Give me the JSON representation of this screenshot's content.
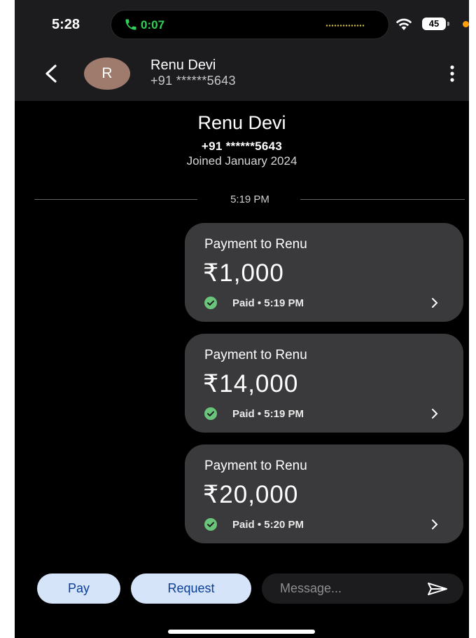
{
  "status_bar": {
    "time": "5:28",
    "call_timer": "0:07",
    "battery": "45",
    "icons": [
      "phone-call-icon",
      "wifi-icon",
      "battery-icon"
    ],
    "call_color": "#30d158",
    "indicator_color": "#ff9f0a"
  },
  "header": {
    "back_icon": "chevron-left-icon",
    "avatar_initial": "R",
    "avatar_color": "#9e7b6c",
    "name": "Renu Devi",
    "phone": "+91 ******5643",
    "menu_icon": "more-vertical-icon"
  },
  "contact": {
    "name": "Renu Devi",
    "phone": "+91 ******5643",
    "joined": "Joined January 2024"
  },
  "divider_time": "5:19 PM",
  "payments": [
    {
      "title": "Payment to Renu",
      "amount": "₹1,000",
      "status": "Paid • 5:19 PM"
    },
    {
      "title": "Payment to Renu",
      "amount": "₹14,000",
      "status": "Paid • 5:19 PM"
    },
    {
      "title": "Payment to Renu",
      "amount": "₹20,000",
      "status": "Paid • 5:20 PM"
    }
  ],
  "status_icon_color": "#6ac47a",
  "bottom_bar": {
    "pay_label": "Pay",
    "request_label": "Request",
    "message_placeholder": "Message...",
    "send_icon": "send-icon",
    "button_color": "#d6e4fa"
  }
}
